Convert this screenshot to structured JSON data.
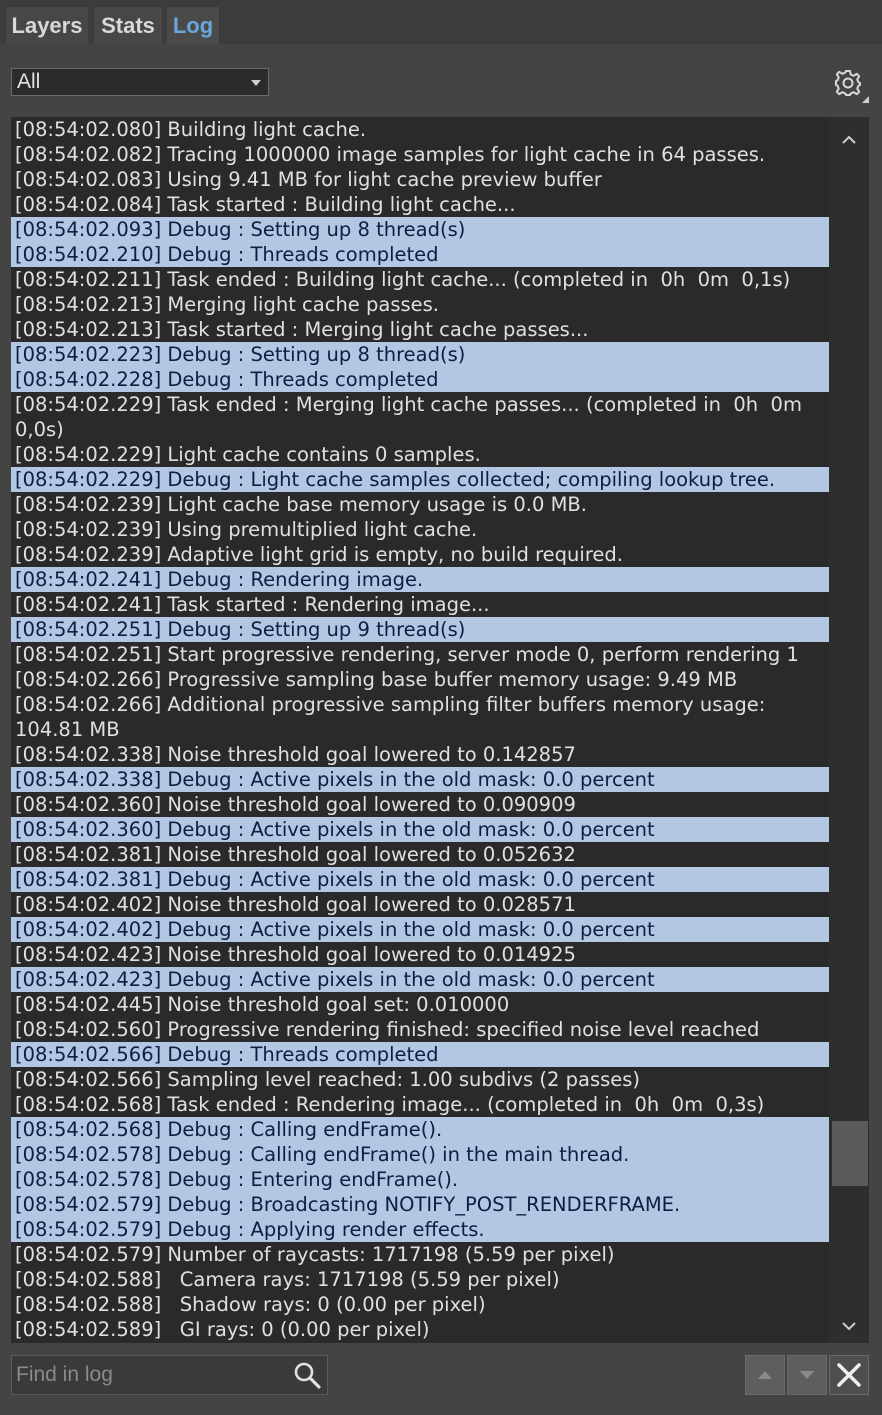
{
  "tabs": [
    {
      "label": "Layers",
      "active": false
    },
    {
      "label": "Stats",
      "active": false
    },
    {
      "label": "Log",
      "active": true
    }
  ],
  "filter": {
    "selected": "All"
  },
  "icons": {
    "settings": "gear-icon",
    "search": "search-icon",
    "up": "chevron-up-icon",
    "down": "chevron-down-icon",
    "close": "close-icon"
  },
  "colors": {
    "debug_row_bg": "#b3c6e2",
    "debug_row_text": "#0f1d45",
    "active_tab": "#6aa6dc"
  },
  "log": {
    "lines": [
      {
        "text": "[08:54:02.080] Building light cache.",
        "debug": false
      },
      {
        "text": "[08:54:02.082] Tracing 1000000 image samples for light cache in 64 passes.",
        "debug": false
      },
      {
        "text": "[08:54:02.083] Using 9.41 MB for light cache preview buffer",
        "debug": false
      },
      {
        "text": "[08:54:02.084] Task started : Building light cache...",
        "debug": false
      },
      {
        "text": "[08:54:02.093] Debug : Setting up 8 thread(s)",
        "debug": true
      },
      {
        "text": "[08:54:02.210] Debug : Threads completed",
        "debug": true
      },
      {
        "text": "[08:54:02.211] Task ended : Building light cache... (completed in  0h  0m  0,1s)",
        "debug": false
      },
      {
        "text": "[08:54:02.213] Merging light cache passes.",
        "debug": false
      },
      {
        "text": "[08:54:02.213] Task started : Merging light cache passes...",
        "debug": false
      },
      {
        "text": "[08:54:02.223] Debug : Setting up 8 thread(s)",
        "debug": true
      },
      {
        "text": "[08:54:02.228] Debug : Threads completed",
        "debug": true
      },
      {
        "text": "[08:54:02.229] Task ended : Merging light cache passes... (completed in  0h  0m  0,0s)",
        "debug": false
      },
      {
        "text": "[08:54:02.229] Light cache contains 0 samples.",
        "debug": false
      },
      {
        "text": "[08:54:02.229] Debug : Light cache samples collected; compiling lookup tree.",
        "debug": true
      },
      {
        "text": "[08:54:02.239] Light cache base memory usage is 0.0 MB.",
        "debug": false
      },
      {
        "text": "[08:54:02.239] Using premultiplied light cache.",
        "debug": false
      },
      {
        "text": "[08:54:02.239] Adaptive light grid is empty, no build required.",
        "debug": false
      },
      {
        "text": "[08:54:02.241] Debug : Rendering image.",
        "debug": true
      },
      {
        "text": "[08:54:02.241] Task started : Rendering image...",
        "debug": false
      },
      {
        "text": "[08:54:02.251] Debug : Setting up 9 thread(s)",
        "debug": true
      },
      {
        "text": "[08:54:02.251] Start progressive rendering, server mode 0, perform rendering 1",
        "debug": false
      },
      {
        "text": "[08:54:02.266] Progressive sampling base buffer memory usage: 9.49 MB",
        "debug": false
      },
      {
        "text": "[08:54:02.266] Additional progressive sampling filter buffers memory usage: 104.81 MB",
        "debug": false
      },
      {
        "text": "[08:54:02.338] Noise threshold goal lowered to 0.142857",
        "debug": false
      },
      {
        "text": "[08:54:02.338] Debug : Active pixels in the old mask: 0.0 percent",
        "debug": true
      },
      {
        "text": "[08:54:02.360] Noise threshold goal lowered to 0.090909",
        "debug": false
      },
      {
        "text": "[08:54:02.360] Debug : Active pixels in the old mask: 0.0 percent",
        "debug": true
      },
      {
        "text": "[08:54:02.381] Noise threshold goal lowered to 0.052632",
        "debug": false
      },
      {
        "text": "[08:54:02.381] Debug : Active pixels in the old mask: 0.0 percent",
        "debug": true
      },
      {
        "text": "[08:54:02.402] Noise threshold goal lowered to 0.028571",
        "debug": false
      },
      {
        "text": "[08:54:02.402] Debug : Active pixels in the old mask: 0.0 percent",
        "debug": true
      },
      {
        "text": "[08:54:02.423] Noise threshold goal lowered to 0.014925",
        "debug": false
      },
      {
        "text": "[08:54:02.423] Debug : Active pixels in the old mask: 0.0 percent",
        "debug": true
      },
      {
        "text": "[08:54:02.445] Noise threshold goal set: 0.010000",
        "debug": false
      },
      {
        "text": "[08:54:02.560] Progressive rendering finished: specified noise level reached",
        "debug": false
      },
      {
        "text": "[08:54:02.566] Debug : Threads completed",
        "debug": true
      },
      {
        "text": "[08:54:02.566] Sampling level reached: 1.00 subdivs (2 passes)",
        "debug": false
      },
      {
        "text": "[08:54:02.568] Task ended : Rendering image... (completed in  0h  0m  0,3s)",
        "debug": false
      },
      {
        "text": "[08:54:02.568] Debug : Calling endFrame().",
        "debug": true
      },
      {
        "text": "[08:54:02.578] Debug : Calling endFrame() in the main thread.",
        "debug": true
      },
      {
        "text": "[08:54:02.578] Debug : Entering endFrame().",
        "debug": true
      },
      {
        "text": "[08:54:02.579] Debug : Broadcasting NOTIFY_POST_RENDERFRAME.",
        "debug": true
      },
      {
        "text": "[08:54:02.579] Debug : Applying render effects.",
        "debug": true
      },
      {
        "text": "[08:54:02.579] Number of raycasts: 1717198 (5.59 per pixel)",
        "debug": false
      },
      {
        "text": "[08:54:02.588]   Camera rays: 1717198 (5.59 per pixel)",
        "debug": false
      },
      {
        "text": "[08:54:02.588]   Shadow rays: 0 (0.00 per pixel)",
        "debug": false
      },
      {
        "text": "[08:54:02.589]   GI rays: 0 (0.00 per pixel)",
        "debug": false
      }
    ]
  },
  "search": {
    "placeholder": "Find in log",
    "value": ""
  }
}
